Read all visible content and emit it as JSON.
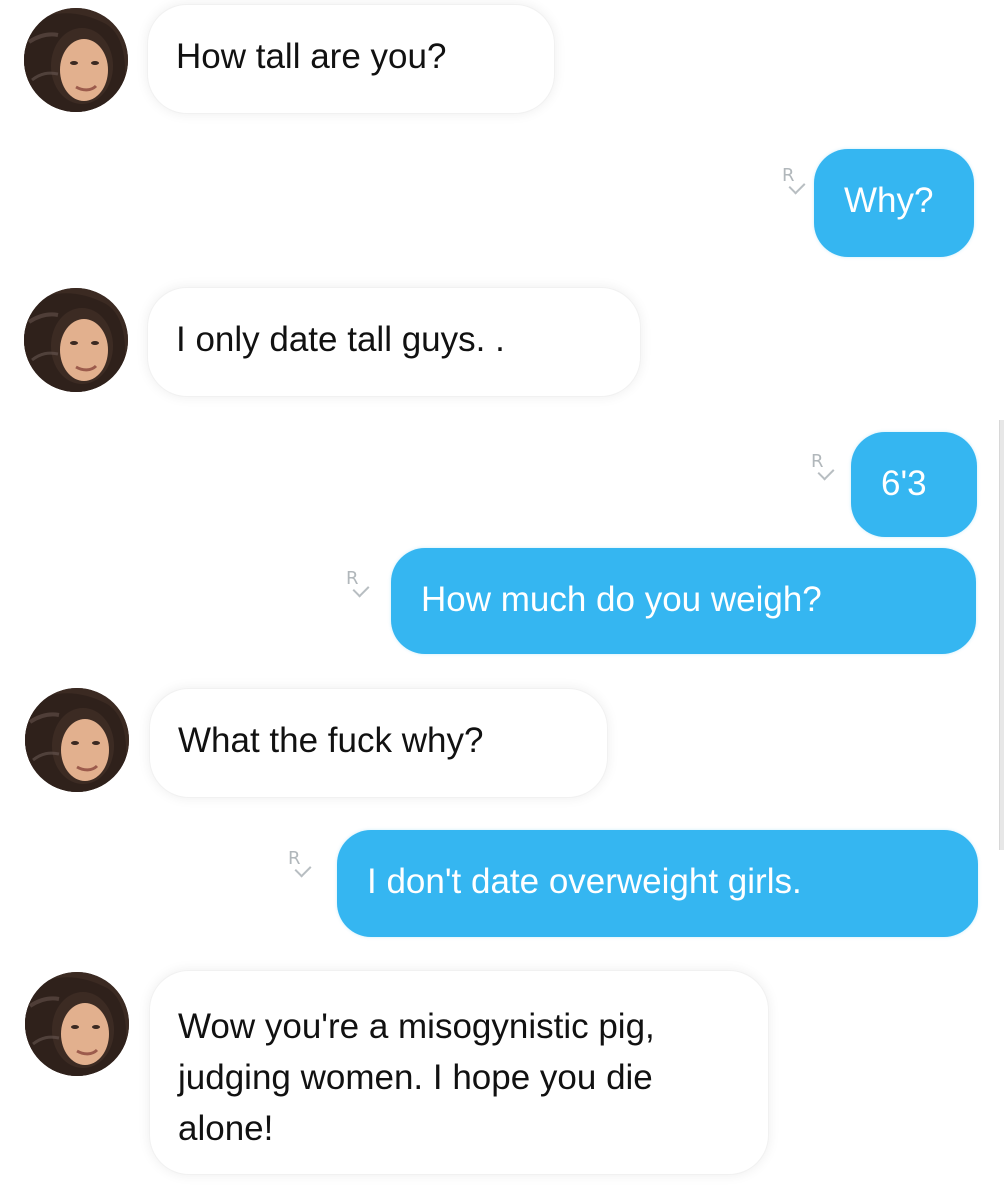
{
  "messages": [
    {
      "side": "received",
      "text": "How tall are you?"
    },
    {
      "side": "sent",
      "text": "Why?",
      "receipt": "R"
    },
    {
      "side": "received",
      "text": "I only date tall guys. ."
    },
    {
      "side": "sent",
      "text": "6'3",
      "receipt": "R"
    },
    {
      "side": "sent",
      "text": "How much do you weigh?",
      "receipt": "R"
    },
    {
      "side": "received",
      "text": "What the fuck why?"
    },
    {
      "side": "sent",
      "text": "I don't date overweight girls.",
      "receipt": "R"
    },
    {
      "side": "received",
      "text": "Wow you're a misogynistic pig, judging women. I hope you die alone!"
    }
  ],
  "colors": {
    "sent_bubble": "#35b6f1",
    "received_bubble": "#ffffff",
    "received_text": "#111111",
    "sent_text": "#ffffff",
    "receipt": "#b1b7bb"
  },
  "icons": {
    "avatar": "contact-avatar-photo",
    "receipt": "read-receipt-icon"
  }
}
